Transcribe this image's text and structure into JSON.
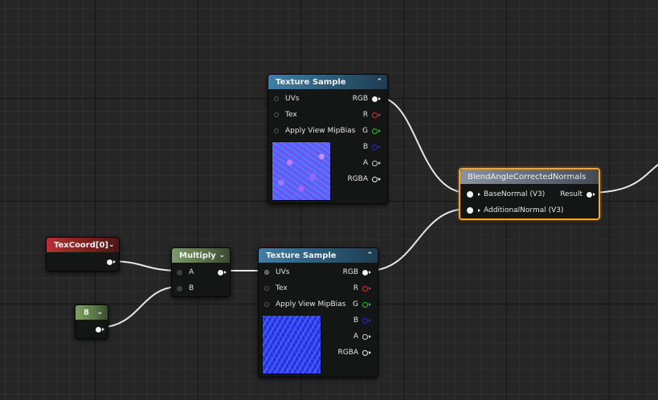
{
  "nodes": {
    "texture_sample_1": {
      "title": "Texture Sample",
      "inputs": [
        "UVs",
        "Tex",
        "Apply View MipBias"
      ],
      "outputs": [
        "RGB",
        "R",
        "G",
        "B",
        "A",
        "RGBA"
      ]
    },
    "texture_sample_2": {
      "title": "Texture Sample",
      "inputs": [
        "UVs",
        "Tex",
        "Apply View MipBias"
      ],
      "outputs": [
        "RGB",
        "R",
        "G",
        "B",
        "A",
        "RGBA"
      ]
    },
    "texcoord": {
      "title": "TexCoord[0]"
    },
    "multiply": {
      "title": "Multiply",
      "inputs": [
        "A",
        "B"
      ]
    },
    "constant": {
      "title": "8"
    },
    "blend": {
      "title": "BlendAngleCorrectedNormals",
      "inputs": [
        "BaseNormal (V3)",
        "AdditionalNormal (V3)"
      ],
      "output": "Result"
    }
  },
  "colors": {
    "wire": "#e8e8e8",
    "pin_r": "#e03030",
    "pin_g": "#30c030",
    "pin_b": "#2a2ad0",
    "pin_a": "#cfcfcf",
    "selection": "#f5a623"
  }
}
